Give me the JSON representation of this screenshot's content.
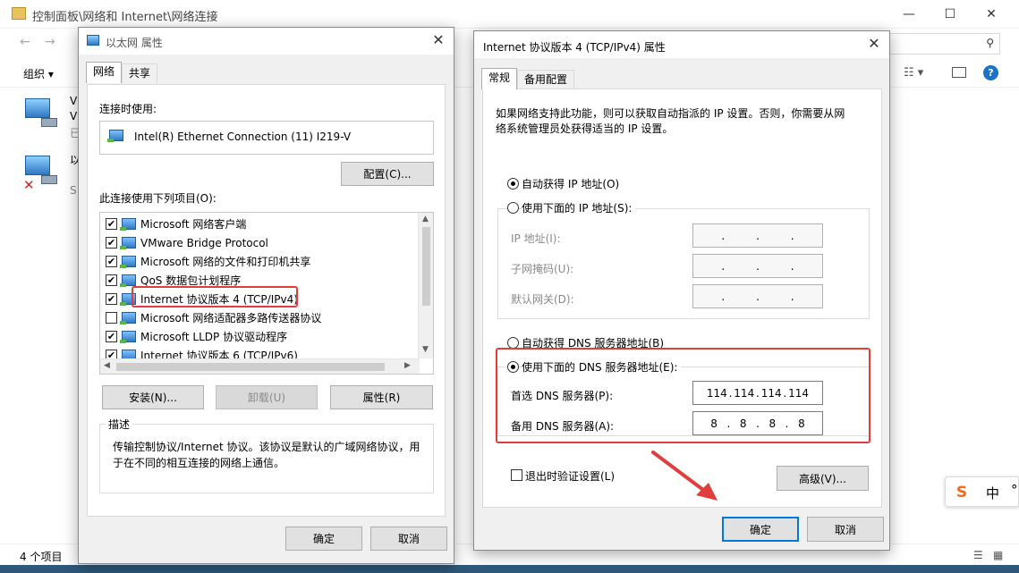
{
  "explorer": {
    "title": "控制面板\\网络和 Internet\\网络连接",
    "organize": "组织",
    "item_partial_1": "V",
    "item_partial_1b": "V",
    "item_partial_1c": "已",
    "item_partial_2": "以",
    "item_partial_2b": "S",
    "status": "4 个项目"
  },
  "ethernet_dialog": {
    "title": "以太网 属性",
    "tabs": [
      "网络",
      "共享"
    ],
    "connect_using_label": "连接时使用:",
    "adapter_name": "Intel(R) Ethernet Connection (11) I219-V",
    "configure_button": "配置(C)...",
    "items_label": "此连接使用下列项目(O):",
    "items": [
      {
        "label": "Microsoft 网络客户端",
        "checked": true
      },
      {
        "label": "VMware Bridge Protocol",
        "checked": true
      },
      {
        "label": "Microsoft 网络的文件和打印机共享",
        "checked": true
      },
      {
        "label": "QoS 数据包计划程序",
        "checked": true
      },
      {
        "label": "Internet 协议版本 4 (TCP/IPv4)",
        "checked": true
      },
      {
        "label": "Microsoft 网络适配器多路传送器协议",
        "checked": false
      },
      {
        "label": "Microsoft LLDP 协议驱动程序",
        "checked": true
      },
      {
        "label": "Internet 协议版本 6 (TCP/IPv6)",
        "checked": true
      }
    ],
    "install_button": "安装(N)...",
    "uninstall_button": "卸载(U)",
    "properties_button": "属性(R)",
    "description_label": "描述",
    "description_text_1": "传输控制协议/Internet 协议。该协议是默认的广域网络协议，用",
    "description_text_2": "于在不同的相互连接的网络上通信。",
    "ok_button": "确定",
    "cancel_button": "取消"
  },
  "ipv4_dialog": {
    "title": "Internet 协议版本 4 (TCP/IPv4) 属性",
    "tabs": [
      "常规",
      "备用配置"
    ],
    "intro_1": "如果网络支持此功能，则可以获取自动指派的 IP 设置。否则，你需要从网",
    "intro_2": "络系统管理员处获得适当的 IP 设置。",
    "auto_ip": "自动获得 IP 地址(O)",
    "manual_ip": "使用下面的 IP 地址(S):",
    "ip_address_label": "IP 地址(I):",
    "subnet_label": "子网掩码(U):",
    "gateway_label": "默认网关(D):",
    "auto_dns": "自动获得 DNS 服务器地址(B)",
    "manual_dns": "使用下面的 DNS 服务器地址(E):",
    "preferred_dns_label": "首选 DNS 服务器(P):",
    "preferred_dns": [
      "114",
      "114",
      "114",
      "114"
    ],
    "alternate_dns_label": "备用 DNS 服务器(A):",
    "alternate_dns": [
      "8",
      "8",
      "8",
      "8"
    ],
    "validate_label": "退出时验证设置(L)",
    "advanced_button": "高级(V)...",
    "ok_button": "确定",
    "cancel_button": "取消"
  },
  "ime": {
    "logo": "S",
    "mode": "中",
    "extra": "°"
  },
  "colors": {
    "highlight": "#e23d3d",
    "primary_border": "#0078d7"
  }
}
